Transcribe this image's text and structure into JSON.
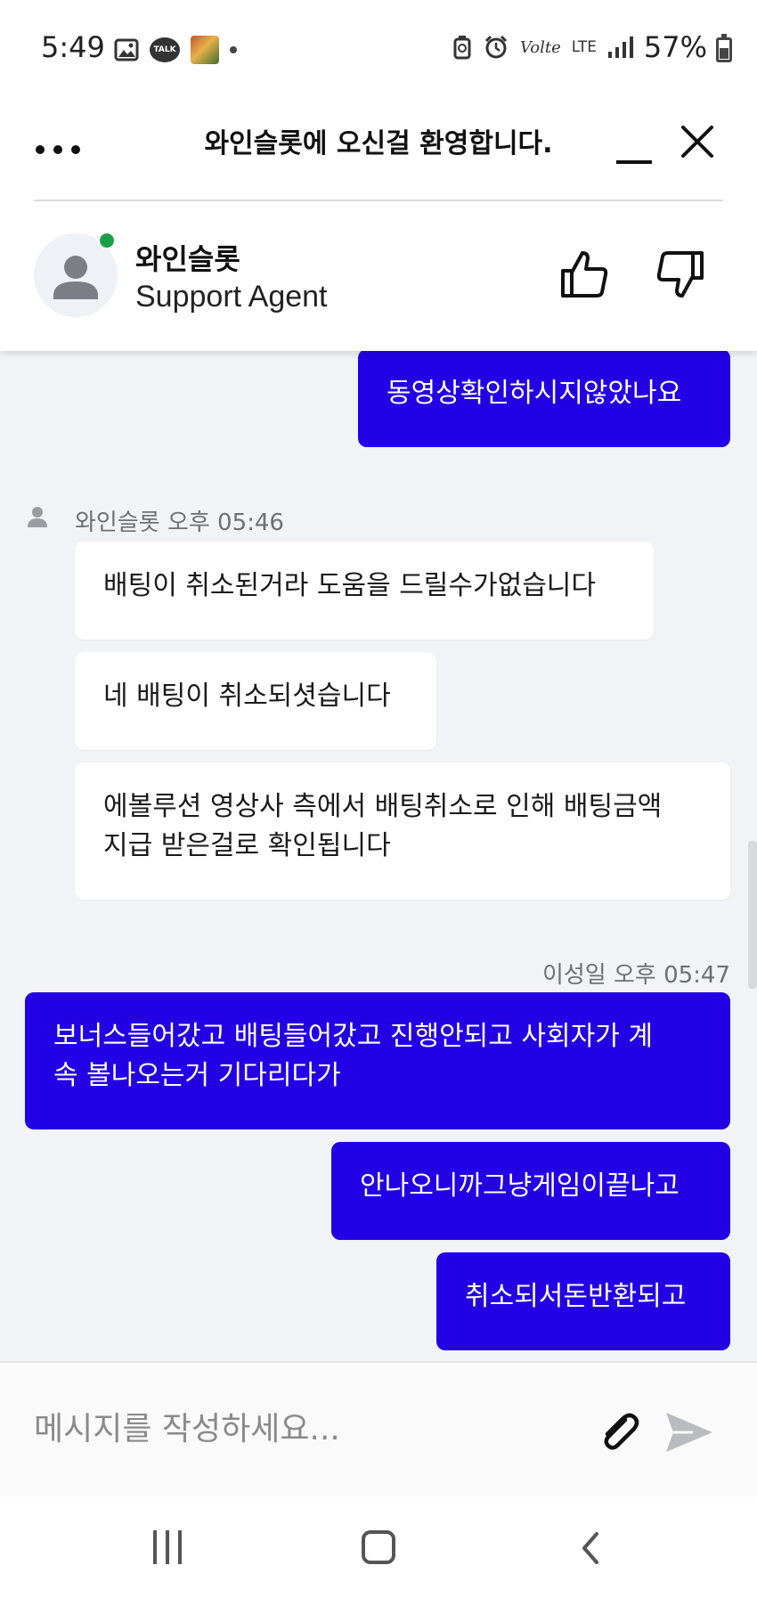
{
  "status_bar": {
    "time": "5:49",
    "talk_label": "TALK",
    "network_label": "LTE",
    "volte_label": "Volte",
    "battery": "57%"
  },
  "header": {
    "title": "와인슬롯에 오신걸 환영합니다."
  },
  "agent": {
    "name": "와인슬롯",
    "role": "Support Agent",
    "status_color": "#1f9e4a"
  },
  "messages": [
    {
      "sender": "user",
      "text": "동영상확인하시지않았나요"
    },
    {
      "sender": "agent_meta",
      "text": "와인슬롯 오후 05:46"
    },
    {
      "sender": "agent",
      "text": "배팅이 취소된거라 도움을 드릴수가없습니다"
    },
    {
      "sender": "agent",
      "text": "네 배팅이 취소되셧습니다"
    },
    {
      "sender": "agent",
      "text": "에볼루션 영상사 측에서 배팅취소로 인해 배팅금액\n지급 받은걸로 확인됩니다"
    },
    {
      "sender": "user_meta",
      "text": "이성일 오후 05:47"
    },
    {
      "sender": "user",
      "text": "보너스들어갔고 배팅들어갔고 진행안되고 사회자가 계\n속 볼나오는거 기다리다가"
    },
    {
      "sender": "user",
      "text": "안나오니까그냥게임이끝나고"
    },
    {
      "sender": "user",
      "text": "취소되서돈반환되고"
    }
  ],
  "composer": {
    "placeholder": "메시지를 작성하세요..."
  },
  "colors": {
    "user_bubble": "#2300e3",
    "agent_bubble": "#ffffff",
    "chat_background": "#f2f3f6"
  },
  "icons": [
    "more-icon",
    "minimize-icon",
    "close-icon",
    "person-icon",
    "thumbs-up-icon",
    "thumbs-down-icon",
    "paperclip-icon",
    "send-icon",
    "recents-icon",
    "home-icon",
    "back-icon"
  ]
}
